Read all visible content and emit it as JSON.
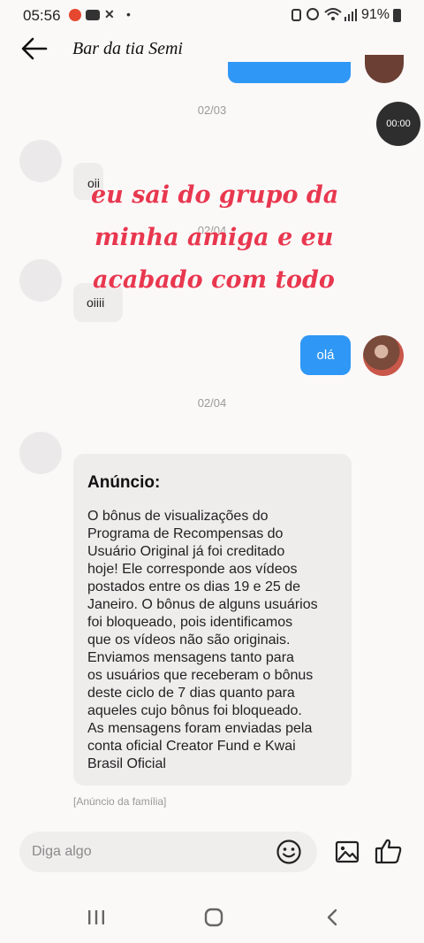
{
  "status_bar": {
    "time": "05:56",
    "dot": "•",
    "battery": "91%",
    "icons": [
      "app-notification-icon",
      "youtube-icon",
      "capcut-icon",
      "nfc-icon",
      "alarm-icon",
      "wifi-icon",
      "signal-icon",
      "battery-icon"
    ]
  },
  "header": {
    "title": "Bar da tia Semi"
  },
  "timer": "00:00",
  "messages": {
    "date1": "02/03",
    "msg1": "oii",
    "date2": "02/04",
    "msg2": "oiiii",
    "out1": "olá",
    "date3": "02/04"
  },
  "overlay_text": {
    "line1": "eu sai do grupo da",
    "line2": "minha amiga e eu",
    "line3": "acabado com todo"
  },
  "announcement": {
    "title": "Anúncio:",
    "lines": [
      "O bônus de visualizações do",
      "Programa de Recompensas do",
      "Usuário Original já foi creditado",
      "hoje! Ele corresponde aos vídeos",
      "postados entre os dias 19 e 25 de",
      "Janeiro. O bônus de alguns usuários",
      "foi bloqueado, pois identificamos",
      "que os vídeos não são originais.",
      "Enviamos mensagens tanto para",
      "os usuários que receberam o bônus",
      "deste ciclo de 7 dias quanto para",
      "aqueles cujo bônus foi bloqueado.",
      "As mensagens foram enviadas pela",
      "conta oficial Creator Fund e Kwai",
      "Brasil Oficial"
    ],
    "note": "[Anúncio da família]"
  },
  "composer": {
    "placeholder": "Diga algo"
  },
  "colors": {
    "accent": "#2f97f5",
    "overlay_text": "#e8384f",
    "background": "#fbf8f8"
  }
}
